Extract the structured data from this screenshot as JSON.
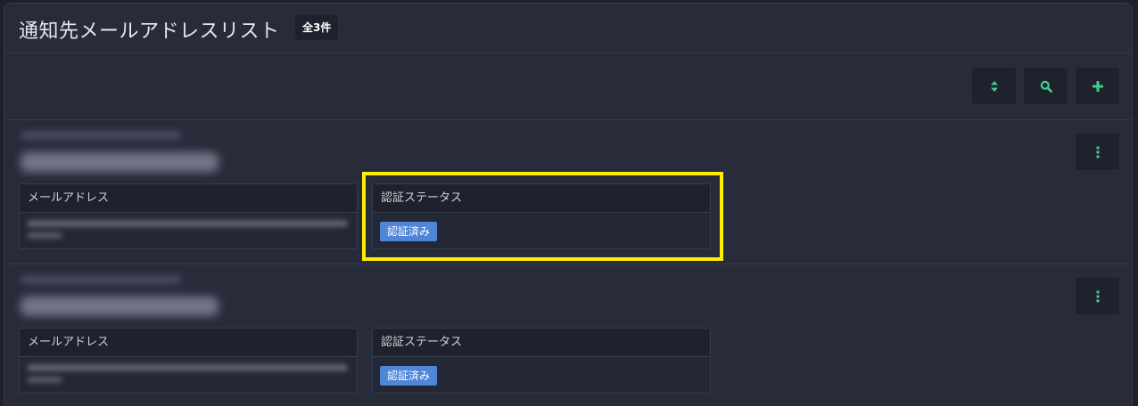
{
  "header": {
    "title": "通知先メールアドレスリスト",
    "count": "全3件"
  },
  "toolbar": {
    "buttons": [
      {
        "icon": "sort-icon",
        "glyph": "⬍"
      },
      {
        "icon": "search-icon",
        "glyph": "search"
      },
      {
        "icon": "plus-icon",
        "glyph": "+"
      }
    ],
    "accent": "#3ecf8e"
  },
  "items": [
    {
      "email_label": "メールアドレス",
      "status_label": "認証ステータス",
      "status_value": "認証済み"
    },
    {
      "email_label": "メールアドレス",
      "status_label": "認証ステータス",
      "status_value": "認証済み"
    }
  ],
  "colors": {
    "status_badge": "#4f86d8",
    "highlight": "#ffee00"
  }
}
